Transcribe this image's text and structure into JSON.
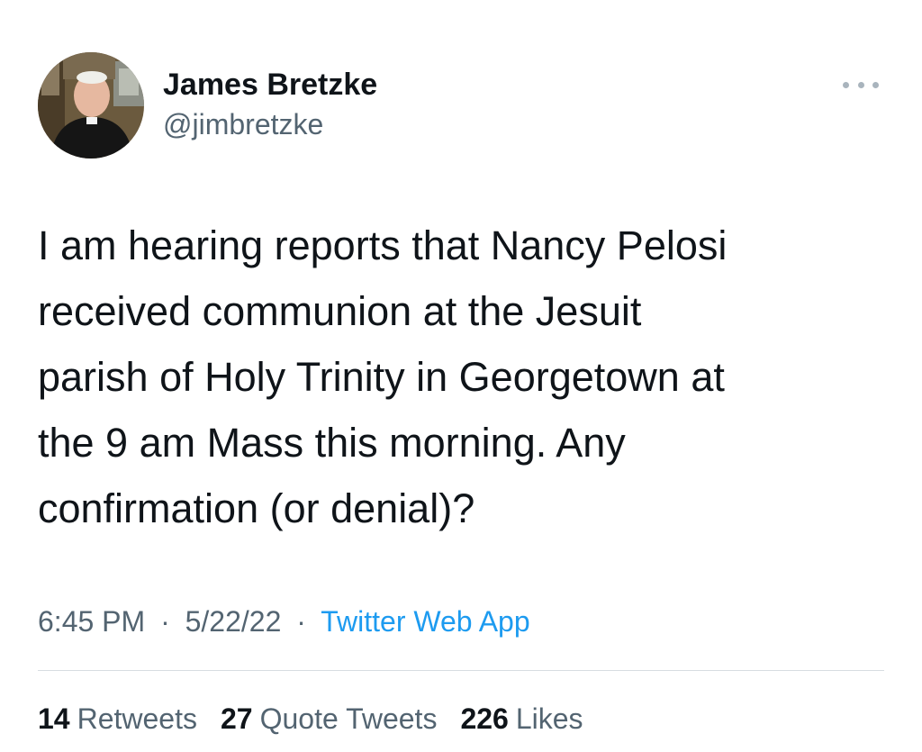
{
  "author": {
    "display_name": "James Bretzke",
    "handle": "@jimbretzke",
    "avatar_icon": "profile-photo"
  },
  "more_icon": "more-options-icon",
  "tweet": {
    "text": "I am hearing reports that Nancy Pelosi\nreceived communion at the Jesuit\nparish of Holy Trinity in Georgetown at\nthe 9 am Mass this morning. Any\nconfirmation (or denial)?"
  },
  "meta": {
    "time": "6:45 PM",
    "separator": "·",
    "date": "5/22/22",
    "source": "Twitter Web App"
  },
  "stats": {
    "retweets_count": "14",
    "retweets_label": "Retweets",
    "quotes_count": "27",
    "quotes_label": "Quote Tweets",
    "likes_count": "226",
    "likes_label": "Likes"
  },
  "colors": {
    "primary_text": "#0f1419",
    "secondary_text": "#536471",
    "link": "#1d9bf0",
    "divider": "#d7dde1"
  }
}
